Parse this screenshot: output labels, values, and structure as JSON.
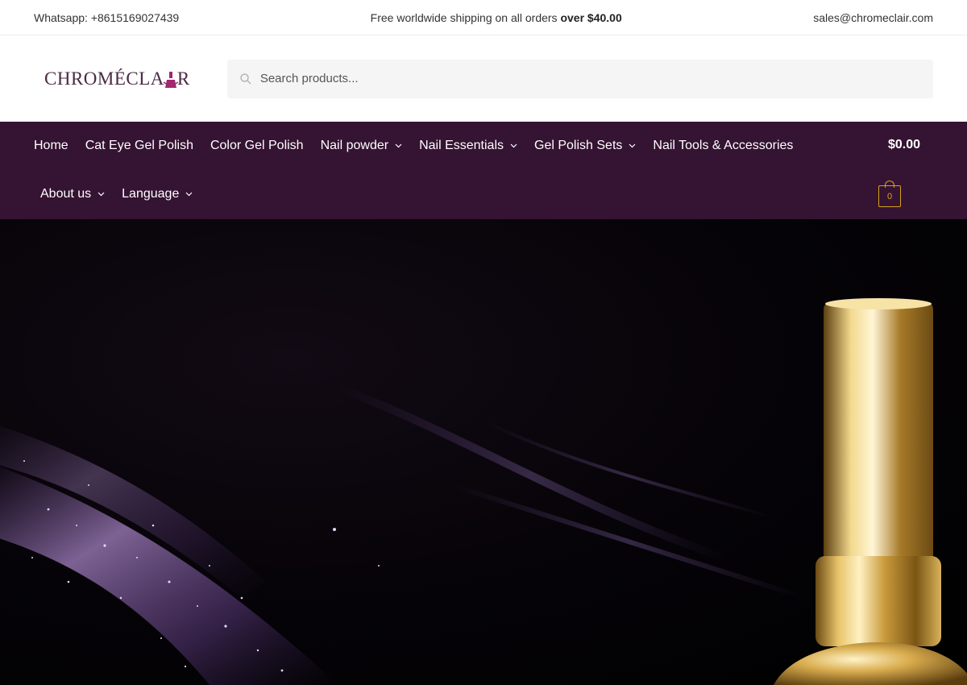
{
  "topbar": {
    "whatsapp": "Whatsapp: +8615169027439",
    "shipping_text": "Free worldwide shipping on all orders ",
    "shipping_bold": "over $40.00",
    "email": "sales@chromeclair.com"
  },
  "logo": {
    "text_left": "CHROMÉCLA",
    "text_right": "R"
  },
  "search": {
    "placeholder": "Search products..."
  },
  "nav": {
    "row1": [
      {
        "label": "Home",
        "has_dropdown": false
      },
      {
        "label": "Cat Eye Gel Polish",
        "has_dropdown": false
      },
      {
        "label": "Color Gel Polish",
        "has_dropdown": false
      },
      {
        "label": "Nail powder",
        "has_dropdown": true
      },
      {
        "label": "Nail Essentials",
        "has_dropdown": true
      },
      {
        "label": "Gel Polish Sets",
        "has_dropdown": true
      },
      {
        "label": "Nail Tools & Accessories",
        "has_dropdown": false
      }
    ],
    "row2": [
      {
        "label": "About us",
        "has_dropdown": true
      },
      {
        "label": "Language",
        "has_dropdown": true
      }
    ]
  },
  "cart": {
    "total": "$0.00",
    "count": "0"
  },
  "colors": {
    "nav_bg": "#351332",
    "accent_gold": "#d6a21d",
    "logo_text": "#4a2a44",
    "logo_mark": "#a0286f"
  }
}
